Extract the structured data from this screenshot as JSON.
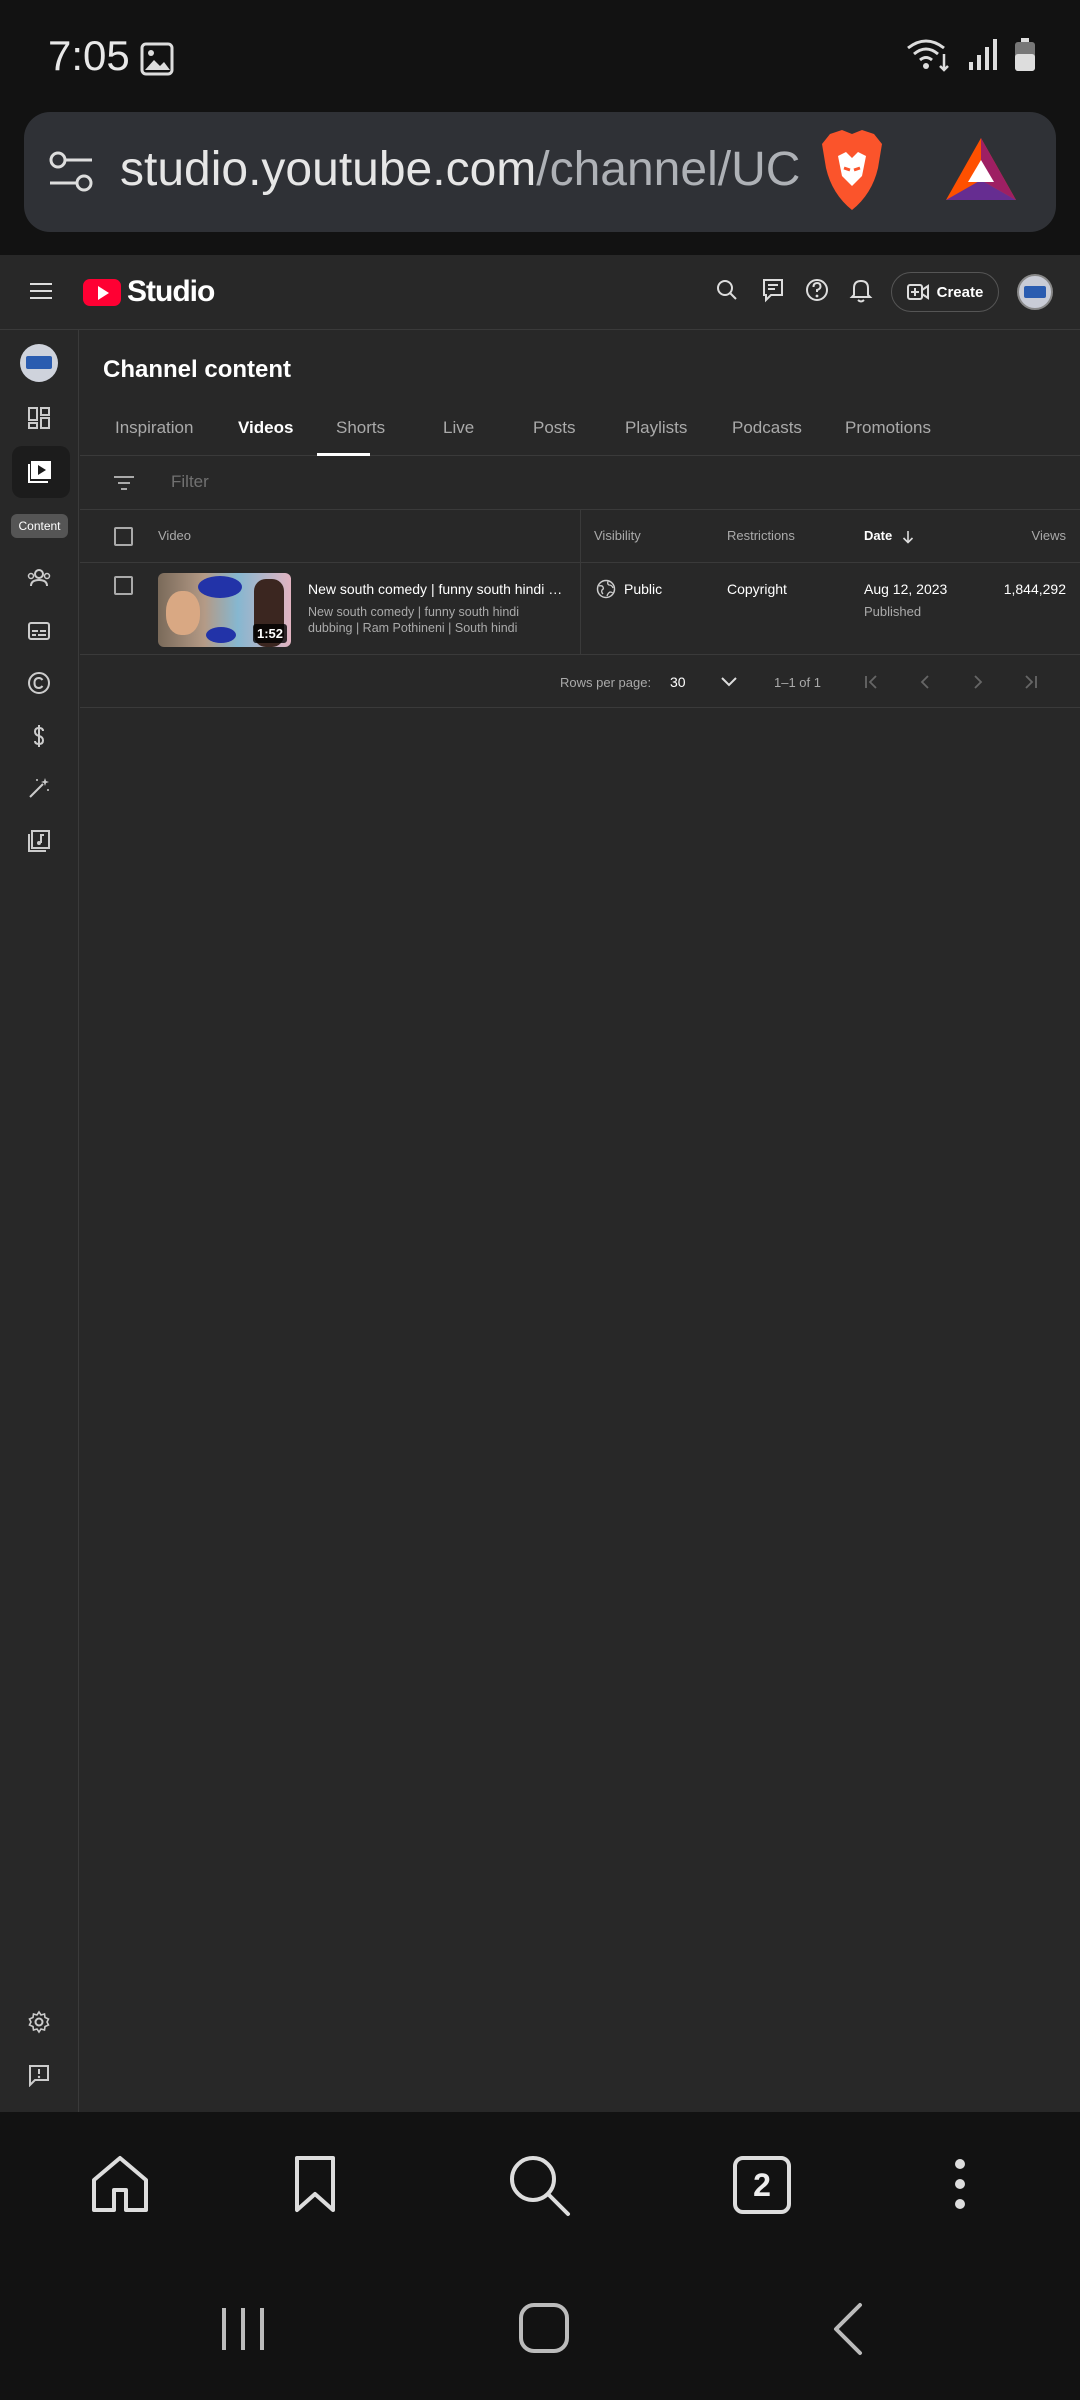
{
  "status_bar": {
    "time": "7:05"
  },
  "browser": {
    "url_host": "studio.youtube.com",
    "url_path": "/channel/UC",
    "tab_count": "2"
  },
  "studio": {
    "logo_text": "Studio",
    "create_label": "Create",
    "rail_active_label": "Content"
  },
  "page": {
    "title": "Channel content",
    "tabs": [
      {
        "label": "Inspiration",
        "active": false
      },
      {
        "label": "Videos",
        "active": true
      },
      {
        "label": "Shorts",
        "active": false
      },
      {
        "label": "Live",
        "active": false
      },
      {
        "label": "Posts",
        "active": false
      },
      {
        "label": "Playlists",
        "active": false
      },
      {
        "label": "Podcasts",
        "active": false
      },
      {
        "label": "Promotions",
        "active": false
      }
    ],
    "filter_placeholder": "Filter"
  },
  "table": {
    "headers": {
      "video": "Video",
      "visibility": "Visibility",
      "restrictions": "Restrictions",
      "date": "Date",
      "views": "Views"
    },
    "rows": [
      {
        "duration": "1:52",
        "title": "New south comedy | funny south hindi dubbing",
        "description": "New south comedy | funny south hindi dubbing | Ram Pothineni | South hindi dubbed",
        "visibility": "Public",
        "restrictions": "Copyright",
        "date": "Aug 12, 2023",
        "date_status": "Published",
        "views": "1,844,292"
      }
    ]
  },
  "pagination": {
    "rows_per_page_label": "Rows per page:",
    "rows_per_page": "30",
    "range": "1–1 of 1"
  },
  "colors": {
    "youtube_red": "#ff0033",
    "background": "#282828"
  }
}
